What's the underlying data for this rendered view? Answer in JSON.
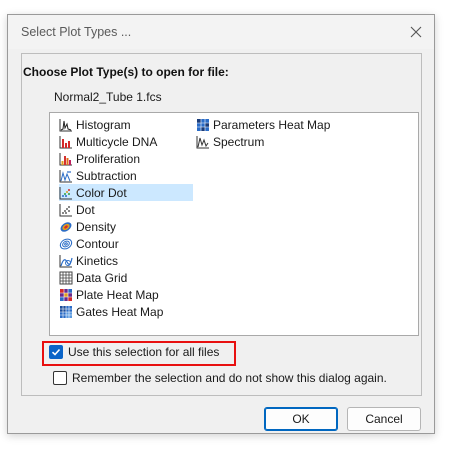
{
  "window": {
    "title": "Select Plot Types ..."
  },
  "prompt": "Choose Plot Type(s) to open for file:",
  "file_name": "Normal2_Tube 1.fcs",
  "plot_types": [
    {
      "label": "Histogram",
      "icon": "histogram-icon"
    },
    {
      "label": "Multicycle DNA",
      "icon": "multicycle-dna-icon"
    },
    {
      "label": "Proliferation",
      "icon": "proliferation-icon"
    },
    {
      "label": "Subtraction",
      "icon": "subtraction-icon"
    },
    {
      "label": "Color Dot",
      "icon": "color-dot-icon",
      "selected": true
    },
    {
      "label": "Dot",
      "icon": "dot-icon"
    },
    {
      "label": "Density",
      "icon": "density-icon"
    },
    {
      "label": "Contour",
      "icon": "contour-icon"
    },
    {
      "label": "Kinetics",
      "icon": "kinetics-icon"
    },
    {
      "label": "Data Grid",
      "icon": "data-grid-icon"
    },
    {
      "label": "Plate Heat Map",
      "icon": "plate-heat-map-icon"
    },
    {
      "label": "Gates Heat Map",
      "icon": "gates-heat-map-icon"
    },
    {
      "label": "Parameters Heat Map",
      "icon": "parameters-heat-map-icon"
    },
    {
      "label": "Spectrum",
      "icon": "spectrum-icon"
    }
  ],
  "options": {
    "use_for_all": {
      "label": "Use this selection for all files",
      "checked": true
    },
    "remember": {
      "label": "Remember the selection and do not show this dialog again.",
      "checked": false
    }
  },
  "buttons": {
    "ok": "OK",
    "cancel": "Cancel"
  },
  "colors": {
    "selection": "#cce8ff",
    "accent": "#0067c0",
    "highlight_box": "#e81010"
  }
}
